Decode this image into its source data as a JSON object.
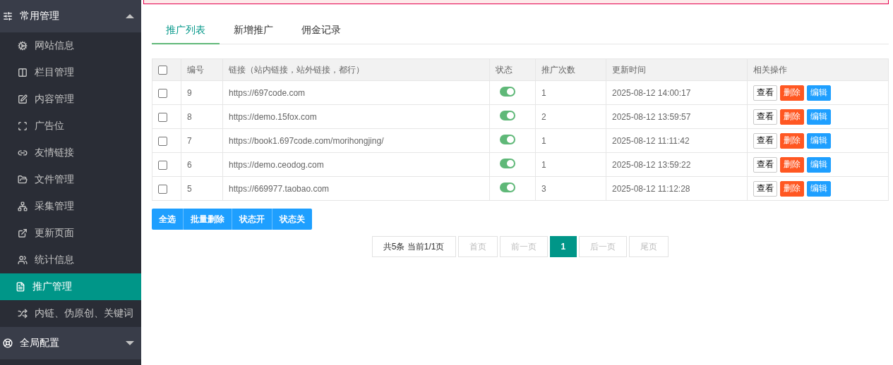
{
  "sidebar": {
    "groups": [
      {
        "title": "常用管理",
        "expanded": true,
        "items": [
          {
            "label": "网站信息",
            "selected": false
          },
          {
            "label": "栏目管理",
            "selected": false
          },
          {
            "label": "内容管理",
            "selected": false
          },
          {
            "label": "广告位",
            "selected": false
          },
          {
            "label": "友情链接",
            "selected": false
          },
          {
            "label": "文件管理",
            "selected": false
          },
          {
            "label": "采集管理",
            "selected": false
          },
          {
            "label": "更新页面",
            "selected": false
          },
          {
            "label": "统计信息",
            "selected": false
          },
          {
            "label": "推广管理",
            "selected": true
          },
          {
            "label": "内链、伪原创、关键词",
            "selected": false
          }
        ]
      },
      {
        "title": "全局配置",
        "expanded": false
      }
    ]
  },
  "tabs": [
    {
      "label": "推广列表",
      "selected": true
    },
    {
      "label": "新增推广",
      "selected": false
    },
    {
      "label": "佣金记录",
      "selected": false
    }
  ],
  "table": {
    "select_all": {
      "checked": false
    },
    "columns": [
      "编号",
      "链接（站内链接，站外链接，都行）",
      "状态",
      "推广次数",
      "更新时间",
      "相关操作"
    ],
    "rows": [
      {
        "checked": false,
        "id": "9",
        "link": "https://697code.com",
        "on": true,
        "count": "1",
        "time": "2025-08-12 14:00:17",
        "actions": [
          {
            "label": "查看",
            "kind": "view"
          },
          {
            "label": "删除",
            "kind": "delete"
          },
          {
            "label": "编辑",
            "kind": "edit"
          }
        ]
      },
      {
        "checked": false,
        "id": "8",
        "link": "https://demo.15fox.com",
        "on": true,
        "count": "2",
        "time": "2025-08-12 13:59:57",
        "actions": [
          {
            "label": "查看",
            "kind": "view"
          },
          {
            "label": "删除",
            "kind": "delete"
          },
          {
            "label": "编辑",
            "kind": "edit"
          }
        ]
      },
      {
        "checked": false,
        "id": "7",
        "link": "https://book1.697code.com/morihongjing/",
        "on": true,
        "count": "1",
        "time": "2025-08-12 11:11:42",
        "actions": [
          {
            "label": "查看",
            "kind": "view"
          },
          {
            "label": "删除",
            "kind": "delete"
          },
          {
            "label": "编辑",
            "kind": "edit"
          }
        ]
      },
      {
        "checked": false,
        "id": "6",
        "link": "https://demo.ceodog.com",
        "on": true,
        "count": "1",
        "time": "2025-08-12 13:59:22",
        "actions": [
          {
            "label": "查看",
            "kind": "view"
          },
          {
            "label": "删除",
            "kind": "delete"
          },
          {
            "label": "编辑",
            "kind": "edit"
          }
        ]
      },
      {
        "checked": false,
        "id": "5",
        "link": "https://669977.taobao.com",
        "on": true,
        "count": "3",
        "time": "2025-08-12 11:12:28",
        "actions": [
          {
            "label": "查看",
            "kind": "view"
          },
          {
            "label": "删除",
            "kind": "delete"
          },
          {
            "label": "编辑",
            "kind": "edit"
          }
        ]
      }
    ]
  },
  "bulk_actions": [
    "全选",
    "批量删除",
    "状态开",
    "状态关"
  ],
  "pagination": [
    {
      "label": "共5条 当前1/1页",
      "kind": "info"
    },
    {
      "label": "首页",
      "kind": "nav",
      "disabled": true
    },
    {
      "label": "前一页",
      "kind": "nav",
      "disabled": true
    },
    {
      "label": "1",
      "kind": "page",
      "selected": true
    },
    {
      "label": "后一页",
      "kind": "nav",
      "disabled": true
    },
    {
      "label": "尾页",
      "kind": "nav",
      "disabled": true
    }
  ]
}
